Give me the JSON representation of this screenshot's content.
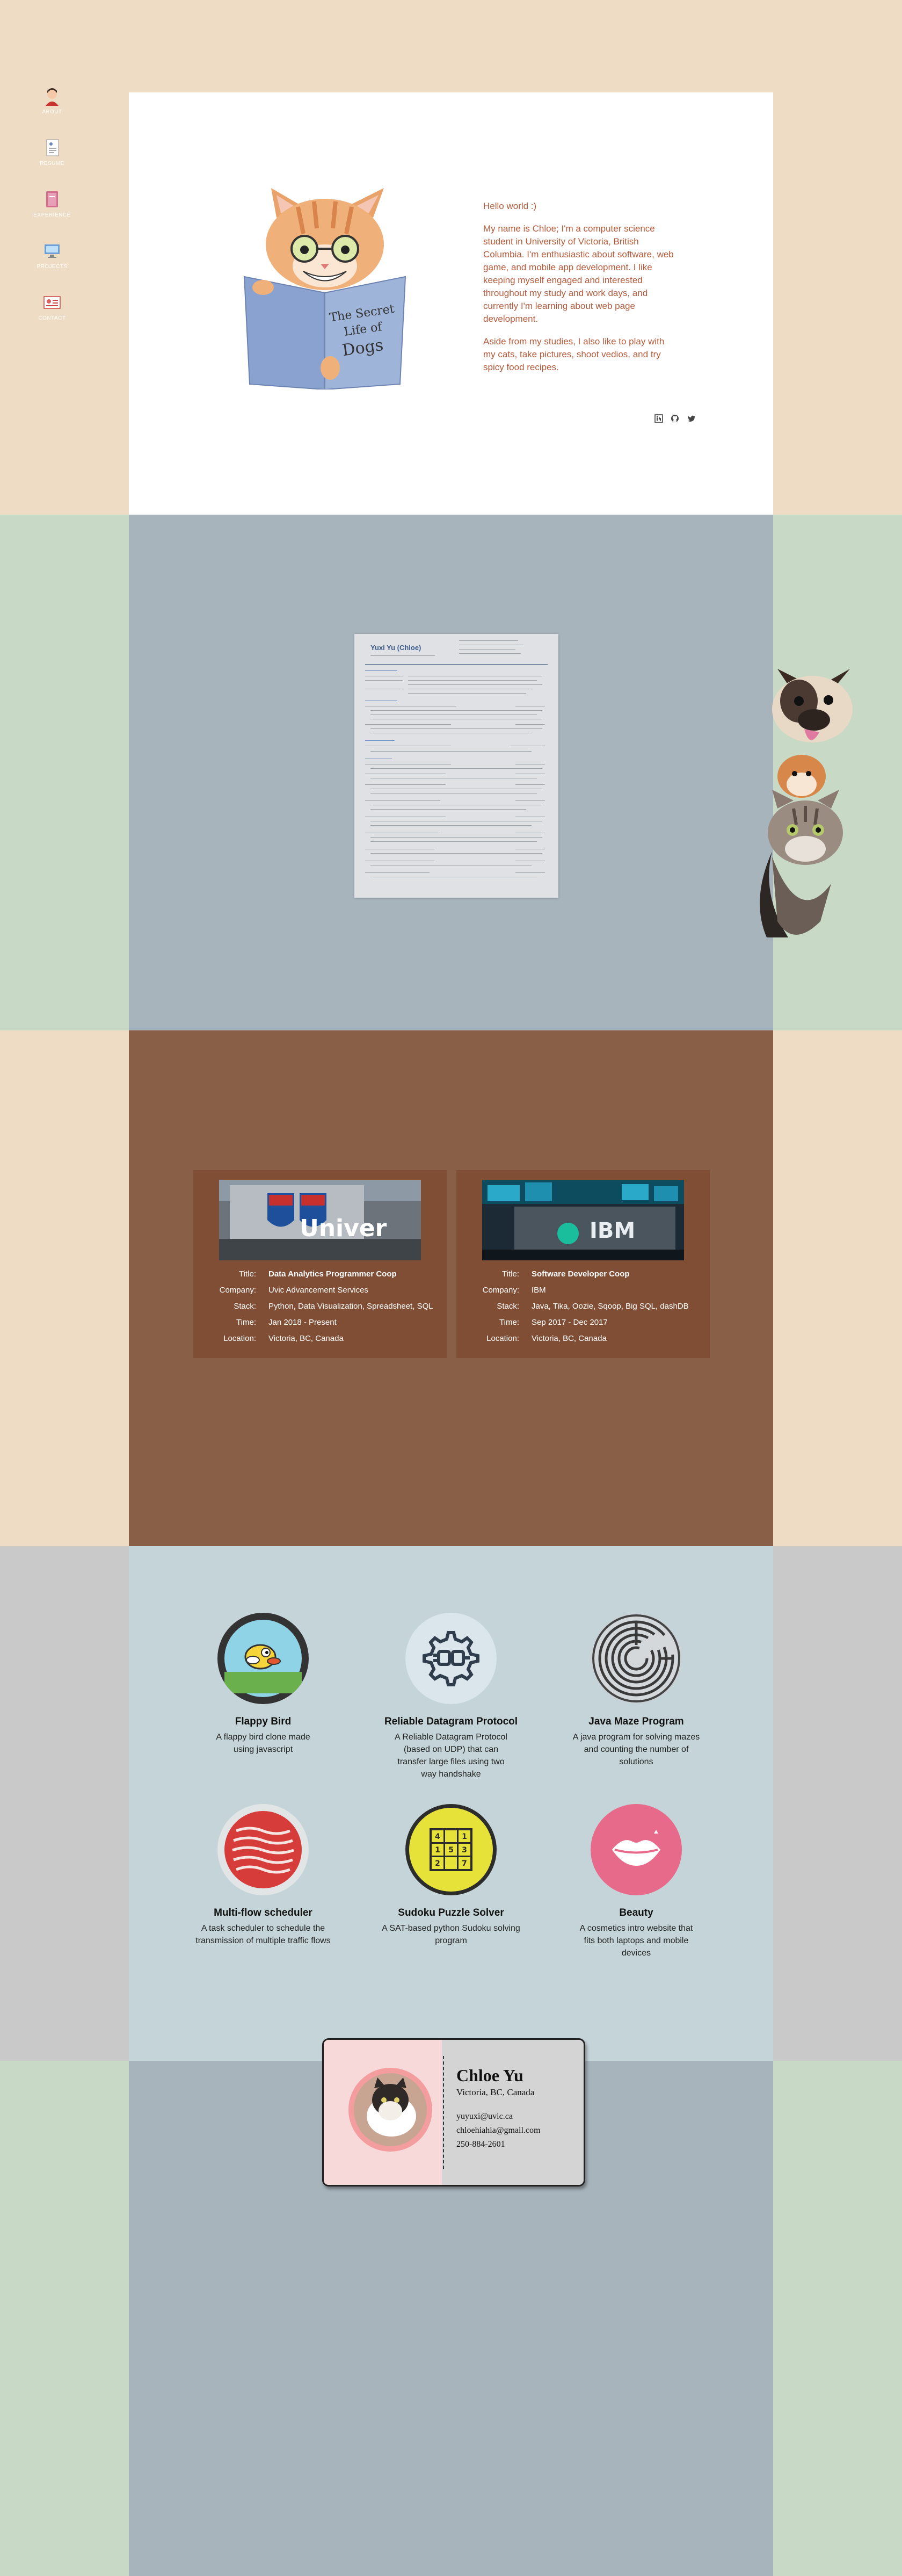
{
  "nav": {
    "items": [
      {
        "label": "ABOUT",
        "icon": "avatar-icon"
      },
      {
        "label": "RESUME",
        "icon": "resume-icon"
      },
      {
        "label": "EXPERIENCE",
        "icon": "book-icon"
      },
      {
        "label": "PROJECTS",
        "icon": "projects-icon"
      },
      {
        "label": "CONTACT",
        "icon": "contact-icon"
      }
    ]
  },
  "about": {
    "image_alt_text": "The Secret Life of Dogs",
    "greeting": "Hello world :)",
    "para1": "My name is Chloe; I'm a computer science student in University of Victoria, British Columbia. I'm enthusiastic about software, web game, and mobile app development. I like keeping myself engaged and interested throughout my study and work days, and currently I'm learning about web page development.",
    "para2": "Aside from my studies, I also like to play with my cats, take pictures, shoot vedios, and try spicy food recipes.",
    "socials": [
      "linkedin-icon",
      "github-icon",
      "twitter-icon"
    ]
  },
  "resume": {
    "name": "Yuxi Yu (Chloe)"
  },
  "experience": [
    {
      "image": "university-sign",
      "image_text": "Univer",
      "labels": {
        "title": "Title:",
        "company": "Company:",
        "stack": "Stack:",
        "time": "Time:",
        "location": "Location:"
      },
      "title": "Data Analytics Programmer Coop",
      "company": "Uvic Advancement Services",
      "stack": "Python, Data Visualization, Spreadsheet, SQL",
      "time": "Jan 2018 - Present",
      "location": "Victoria, BC, Canada"
    },
    {
      "image": "ibm-lobby",
      "image_text": "IBM",
      "labels": {
        "title": "Title:",
        "company": "Company:",
        "stack": "Stack:",
        "time": "Time:",
        "location": "Location:"
      },
      "title": "Software Developer Coop",
      "company": "IBM",
      "stack": "Java, Tika, Oozie, Sqoop, Big SQL, dashDB",
      "time": "Sep 2017 - Dec 2017",
      "location": "Victoria, BC, Canada"
    }
  ],
  "projects": [
    {
      "title": "Flappy Bird",
      "desc": "A flappy bird clone made using javascript",
      "icon": "flappy-bird-icon"
    },
    {
      "title": "Reliable Datagram Protocol",
      "desc": "A Reliable Datagram Protocol (based on UDP) that can transfer large files using two way handshake",
      "icon": "gear-plug-icon"
    },
    {
      "title": "Java Maze Program",
      "desc": "A java program for solving mazes and counting the number of solutions",
      "icon": "maze-icon"
    },
    {
      "title": "Multi-flow scheduler",
      "desc": "A task scheduler to schedule the transmission of multiple traffic flows",
      "icon": "wave-flow-icon"
    },
    {
      "title": "Sudoku Puzzle Solver",
      "desc": "A SAT-based python Sudoku solving program",
      "icon": "sudoku-icon"
    },
    {
      "title": "Beauty",
      "desc": "A cosmetics intro website that fits both laptops and mobile devices",
      "icon": "lips-icon"
    }
  ],
  "contact": {
    "name": "Chloe Yu",
    "location": "Victoria, BC, Canada",
    "email1": "yuyuxi@uvic.ca",
    "email2": "chloehiahia@gmail.com",
    "phone": "250-884-2601"
  },
  "colors": {
    "peach": "#efdcc4",
    "sage": "#c8d9c5",
    "slate": "#a8b4bc",
    "brown": "#8a5f47",
    "gray": "#c9c9c9",
    "light_blue": "#c4d4d8",
    "accent_text": "#b35a3a"
  }
}
